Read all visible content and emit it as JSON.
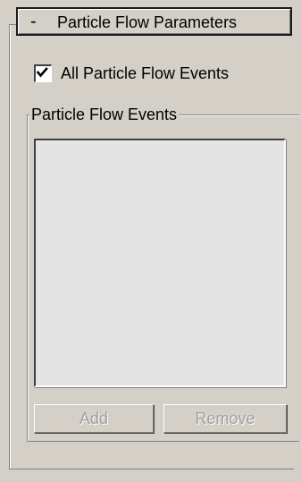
{
  "rollout": {
    "collapse_symbol": "-",
    "title": "Particle Flow Parameters"
  },
  "options": {
    "all_events_label": "All Particle Flow Events",
    "all_events_checked": true
  },
  "events_group": {
    "title": "Particle Flow Events",
    "items": []
  },
  "buttons": {
    "add_label": "Add",
    "remove_label": "Remove",
    "enabled": false
  },
  "icons": {
    "checkmark": "checkmark-icon"
  },
  "colors": {
    "panel_bg": "#d4d0c8",
    "list_bg": "#e4e4e4",
    "disabled_text": "#a0a0a0"
  }
}
